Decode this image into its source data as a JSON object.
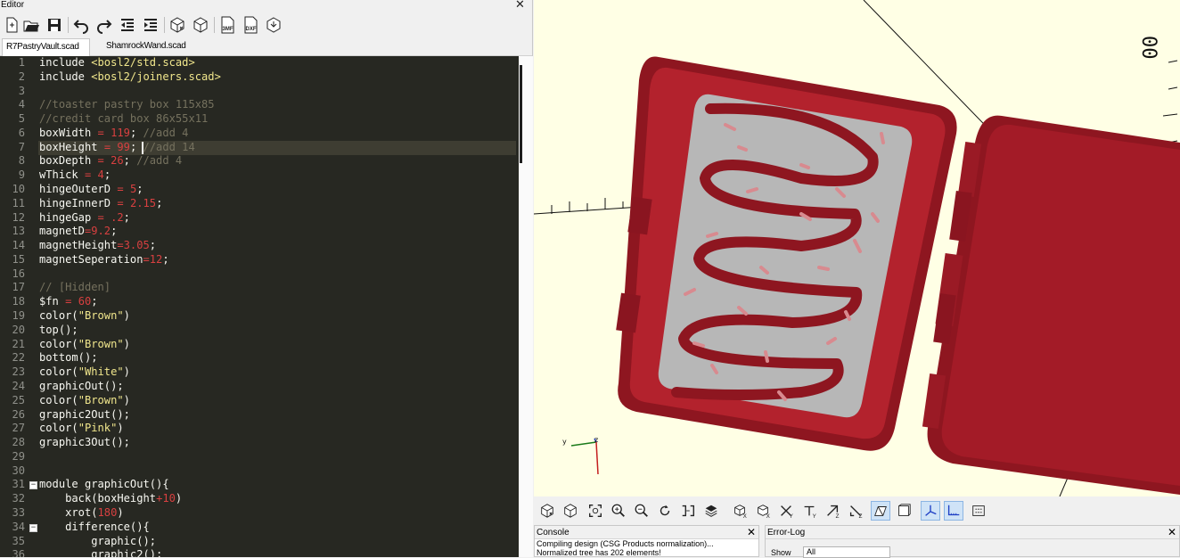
{
  "editor": {
    "title": "Editor",
    "close_glyph": "✕",
    "toolbar": [
      {
        "icon": "new-file-icon"
      },
      {
        "icon": "open-file-icon"
      },
      {
        "icon": "save-icon"
      },
      {
        "icon": "undo-icon"
      },
      {
        "icon": "redo-icon"
      },
      {
        "icon": "unindent-icon"
      },
      {
        "icon": "indent-icon"
      },
      {
        "icon": "preview-icon"
      },
      {
        "icon": "render-icon"
      },
      {
        "icon": "export-3mf-icon",
        "label": "3MF"
      },
      {
        "icon": "export-dxf-icon",
        "label": "DXF"
      },
      {
        "icon": "send-to-printer-icon"
      }
    ],
    "tabs": [
      {
        "label": "R7PastryVault.scad",
        "active": true,
        "close": "✕"
      },
      {
        "label": "ShamrockWand.scad",
        "active": false
      }
    ],
    "cursor_line": 7,
    "lines": [
      [
        [
          "include ",
          "kw"
        ],
        [
          "<bosl2/std.scad>",
          "st"
        ]
      ],
      [
        [
          "include ",
          "kw"
        ],
        [
          "<bosl2/joiners.scad>",
          "st"
        ]
      ],
      [],
      [
        [
          "//toaster pastry box 115x85",
          "cm"
        ]
      ],
      [
        [
          "//credit card box 86x55x11",
          "cm"
        ]
      ],
      [
        [
          "boxWidth ",
          ""
        ],
        [
          "= ",
          "op"
        ],
        [
          "119",
          "nm"
        ],
        [
          "; ",
          ""
        ],
        [
          "//add 4",
          "cm"
        ]
      ],
      [
        [
          "boxHeight ",
          ""
        ],
        [
          "= ",
          "op"
        ],
        [
          "99",
          "nm"
        ],
        [
          "; ",
          ""
        ],
        [
          "//add 14",
          "cm"
        ]
      ],
      [
        [
          "boxDepth ",
          ""
        ],
        [
          "= ",
          "op"
        ],
        [
          "26",
          "nm"
        ],
        [
          "; ",
          ""
        ],
        [
          "//add 4",
          "cm"
        ]
      ],
      [
        [
          "wThick ",
          ""
        ],
        [
          "= ",
          "op"
        ],
        [
          "4",
          "nm"
        ],
        [
          ";",
          ""
        ]
      ],
      [
        [
          "hingeOuterD ",
          ""
        ],
        [
          "= ",
          "op"
        ],
        [
          "5",
          "nm"
        ],
        [
          ";",
          ""
        ]
      ],
      [
        [
          "hingeInnerD ",
          ""
        ],
        [
          "= ",
          "op"
        ],
        [
          "2.15",
          "nm"
        ],
        [
          ";",
          ""
        ]
      ],
      [
        [
          "hingeGap ",
          ""
        ],
        [
          "= ",
          "op"
        ],
        [
          ".2",
          "nm"
        ],
        [
          ";",
          ""
        ]
      ],
      [
        [
          "magnetD",
          ""
        ],
        [
          "=",
          "op"
        ],
        [
          "9.2",
          "nm"
        ],
        [
          ";",
          ""
        ]
      ],
      [
        [
          "magnetHeight",
          ""
        ],
        [
          "=",
          "op"
        ],
        [
          "3.05",
          "nm"
        ],
        [
          ";",
          ""
        ]
      ],
      [
        [
          "magnetSeperation",
          ""
        ],
        [
          "=",
          "op"
        ],
        [
          "12",
          "nm"
        ],
        [
          ";",
          ""
        ]
      ],
      [],
      [
        [
          "// [Hidden]",
          "cm"
        ]
      ],
      [
        [
          "$fn ",
          ""
        ],
        [
          "= ",
          "op"
        ],
        [
          "60",
          "nm"
        ],
        [
          ";",
          ""
        ]
      ],
      [
        [
          "color(",
          ""
        ],
        [
          "\"Brown\"",
          "st"
        ],
        [
          ")",
          ""
        ]
      ],
      [
        [
          "top();",
          ""
        ]
      ],
      [
        [
          "color(",
          ""
        ],
        [
          "\"Brown\"",
          "st"
        ],
        [
          ")",
          ""
        ]
      ],
      [
        [
          "bottom();",
          ""
        ]
      ],
      [
        [
          "color(",
          ""
        ],
        [
          "\"White\"",
          "st"
        ],
        [
          ")",
          ""
        ]
      ],
      [
        [
          "graphicOut();",
          ""
        ]
      ],
      [
        [
          "color(",
          ""
        ],
        [
          "\"Brown\"",
          "st"
        ],
        [
          ")",
          ""
        ]
      ],
      [
        [
          "graphic2Out();",
          ""
        ]
      ],
      [
        [
          "color(",
          ""
        ],
        [
          "\"Pink\"",
          "st"
        ],
        [
          ")",
          ""
        ]
      ],
      [
        [
          "graphic3Out();",
          ""
        ]
      ],
      [],
      [],
      [
        [
          "module graphicOut(){",
          ""
        ]
      ],
      [
        [
          "    back(boxHeight",
          ""
        ],
        [
          "+",
          "op"
        ],
        [
          "10",
          "nm"
        ],
        [
          ")",
          ""
        ]
      ],
      [
        [
          "    xrot(",
          ""
        ],
        [
          "180",
          "nm"
        ],
        [
          ")",
          ""
        ]
      ],
      [
        [
          "    difference(){",
          ""
        ]
      ],
      [
        [
          "        graphic();",
          ""
        ]
      ],
      [
        [
          "        graphic2();",
          ""
        ]
      ]
    ],
    "folds": [
      31,
      34
    ]
  },
  "viewport": {
    "axis_labels": {
      "x": "x",
      "y": "y",
      "z": "z"
    },
    "scale_labels": [
      "100",
      "00"
    ],
    "colors": {
      "background": "#ffffe5",
      "box": "#8e1620",
      "box_light": "#b3222d",
      "insert": "#b7b7b7",
      "sprinkle": "#d88a8f"
    }
  },
  "view_toolbar": [
    {
      "icon": "preview-icon"
    },
    {
      "icon": "render-icon"
    },
    {
      "icon": "view-all-icon"
    },
    {
      "icon": "zoom-in-icon"
    },
    {
      "icon": "zoom-out-icon"
    },
    {
      "icon": "reset-view-icon"
    },
    {
      "icon": "view-diagonal-icon"
    },
    {
      "icon": "view-center-icon"
    },
    {
      "icon": "view-right-icon",
      "sub": "X"
    },
    {
      "icon": "view-top-icon",
      "sub": "X"
    },
    {
      "icon": "view-bottom-icon",
      "sub": "Y"
    },
    {
      "icon": "view-left-icon",
      "sub": "Y"
    },
    {
      "icon": "view-front-icon",
      "sub": "Z"
    },
    {
      "icon": "view-back-icon",
      "sub": "Z"
    },
    {
      "icon": "perspective-icon",
      "active": true
    },
    {
      "icon": "orthogonal-icon"
    },
    {
      "icon": "show-axes-icon",
      "active": true
    },
    {
      "icon": "show-scale-icon",
      "active": true
    },
    {
      "icon": "show-edges-icon"
    }
  ],
  "console": {
    "title": "Console",
    "close_glyph": "✕",
    "lines": [
      "Compiling design (CSG Products normalization)...",
      "Normalized tree has 202 elements!"
    ]
  },
  "error_log": {
    "title": "Error-Log",
    "close_glyph": "✕",
    "show_label": "Show",
    "show_value": "All"
  }
}
